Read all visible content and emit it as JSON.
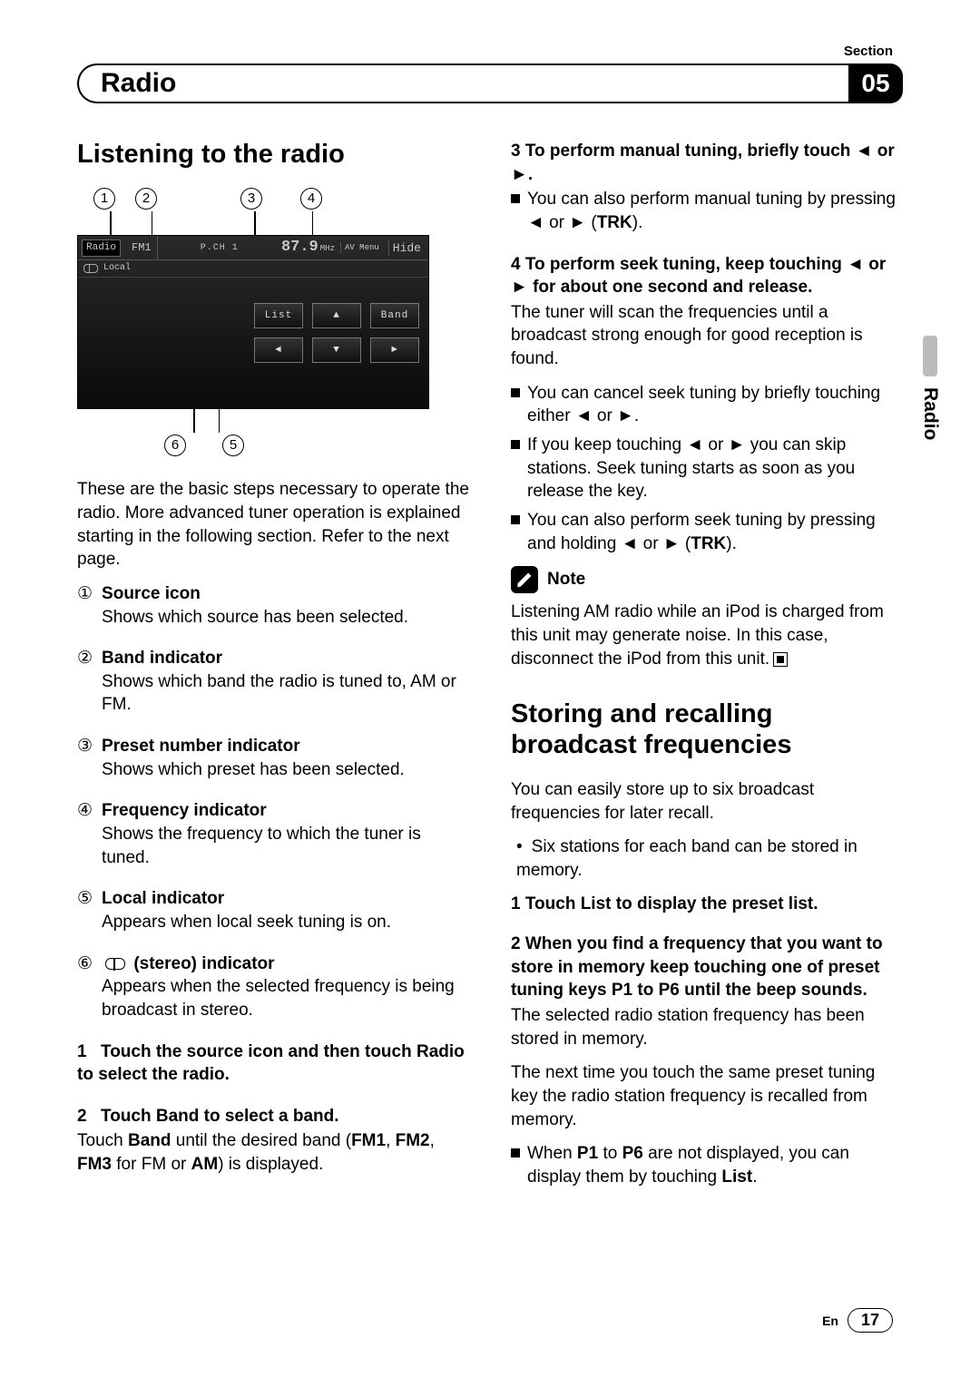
{
  "meta": {
    "section_label": "Section",
    "section_title": "Radio",
    "section_number": "05",
    "side_tab": "Radio",
    "footer_lang": "En",
    "page_number": "17"
  },
  "left": {
    "heading": "Listening to the radio",
    "callouts_top": [
      "1",
      "2",
      "3",
      "4"
    ],
    "callouts_bottom": [
      "6",
      "5"
    ],
    "screen": {
      "source": "Radio",
      "band": "FM1",
      "preset": "P.CH 1",
      "freq_main": "87.9",
      "freq_unit": "MHz",
      "av": "AV Menu",
      "hide": "Hide",
      "local": "Local",
      "btn_list": "List",
      "btn_up": "▲",
      "btn_band": "Band",
      "btn_left": "◄",
      "btn_down": "▼",
      "btn_right": "►"
    },
    "intro": "These are the basic steps necessary to operate the radio. More advanced tuner operation is explained starting in the following section. Refer to the next page.",
    "items": [
      {
        "n": "①",
        "t": "Source icon",
        "d": "Shows which source has been selected."
      },
      {
        "n": "②",
        "t": "Band indicator",
        "d": "Shows which band the radio is tuned to, AM or FM."
      },
      {
        "n": "③",
        "t": "Preset number indicator",
        "d": "Shows which preset has been selected."
      },
      {
        "n": "④",
        "t": "Frequency indicator",
        "d": "Shows the frequency to which the tuner is tuned."
      },
      {
        "n": "⑤",
        "t": "Local indicator",
        "d": "Appears when local seek tuning is on."
      },
      {
        "n": "⑥",
        "t": " (stereo) indicator",
        "d": "Appears when the selected frequency is being broadcast in stereo.",
        "stereo": true
      }
    ],
    "steps": [
      {
        "n": "1",
        "t": "Touch the source icon and then touch Radio to select the radio.",
        "body": ""
      },
      {
        "n": "2",
        "t": "Touch Band to select a band.",
        "body_pre": "Touch ",
        "body_b1": "Band",
        "body_mid": " until the desired band (",
        "body_b2": "FM1",
        "body_mid2": ", ",
        "body_b3": "FM2",
        "body_mid3": ", ",
        "body_b4": "FM3",
        "body_mid4": " for FM or ",
        "body_b5": "AM",
        "body_end": ") is displayed."
      }
    ]
  },
  "right": {
    "step3_title_pre": "3   To perform manual tuning, briefly touch ",
    "step3_title_mid": " or ",
    "step3_title_end": ".",
    "step3_b1_pre": "You can also perform manual tuning by pressing ",
    "step3_b1_mid": " or ",
    "step3_b1_trk": "TRK",
    "step3_b1_end": ").",
    "step4_title_pre": "4   To perform seek tuning, keep touching ",
    "step4_title_mid": " or ",
    "step4_title_end": " for about one second and release.",
    "step4_body": "The tuner will scan the frequencies until a broadcast strong enough for good reception is found.",
    "step4_b1_pre": "You can cancel seek tuning by briefly touching either ",
    "step4_b1_mid": " or ",
    "step4_b1_end": ".",
    "step4_b2_pre": "If you keep touching ",
    "step4_b2_mid": " or ",
    "step4_b2_end": " you can skip stations. Seek tuning starts as soon as you release the key.",
    "step4_b3_pre": "You can also perform seek tuning by pressing and holding ",
    "step4_b3_mid": " or ",
    "step4_b3_trk": "TRK",
    "step4_b3_end": ").",
    "note_label": "Note",
    "note_text": "Listening AM radio while an iPod is charged from this unit may generate noise. In this case, disconnect the iPod from this unit.",
    "heading2": "Storing and recalling broadcast frequencies",
    "store_intro": "You can easily store up to six broadcast frequencies for later recall.",
    "store_bullet": "Six stations for each band can be stored in memory.",
    "store_step1": "1   Touch List to display the preset list.",
    "store_step2": "2   When you find a frequency that you want to store in memory keep touching one of preset tuning keys P1 to P6 until the beep sounds.",
    "store_body1": "The selected radio station frequency has been stored in memory.",
    "store_body2": "The next time you touch the same preset tuning key the radio station frequency is recalled from memory.",
    "store_b1_pre": "When ",
    "store_b1_p1": "P1",
    "store_b1_mid": " to ",
    "store_b1_p6": "P6",
    "store_b1_mid2": " are not displayed, you can display them by touching ",
    "store_b1_list": "List",
    "store_b1_end": "."
  },
  "glyphs": {
    "left_arrow": "◄",
    "right_arrow": "►"
  }
}
